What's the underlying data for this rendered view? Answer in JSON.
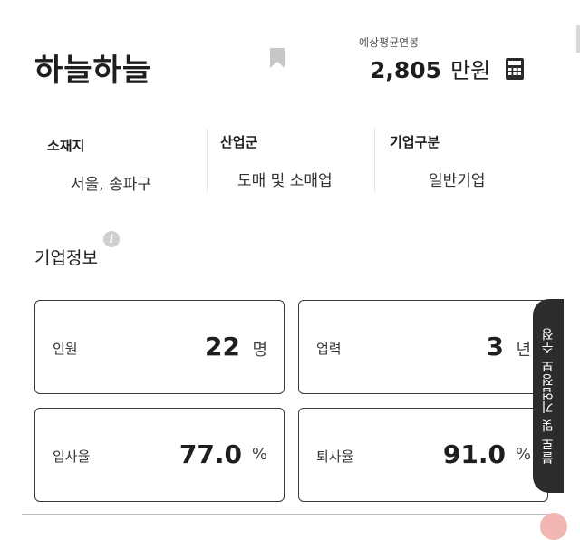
{
  "company": {
    "name": "하늘하늘"
  },
  "salary": {
    "label": "예상평균연봉",
    "value": "2,805",
    "unit": "만원"
  },
  "info": [
    {
      "label": "소재지",
      "value": "서울, 송파구"
    },
    {
      "label": "산업군",
      "value": "도매 및 소매업"
    },
    {
      "label": "기업구분",
      "value": "일반기업"
    }
  ],
  "section": {
    "title": "기업정보",
    "info_icon": "i"
  },
  "stats": {
    "employees": {
      "label": "인원",
      "value": "22",
      "unit": "명"
    },
    "years": {
      "label": "업력",
      "value": "3",
      "unit": "년"
    },
    "hire_rate": {
      "label": "입사율",
      "value": "77.0",
      "unit": "%"
    },
    "quit_rate": {
      "label": "퇴사율",
      "value": "91.0",
      "unit": "%"
    }
  },
  "side_tab": {
    "label": "블로 및 기업정보 수정"
  },
  "icons": {
    "bookmark": "bookmark-icon",
    "calculator": "calculator-icon",
    "info": "info-icon"
  },
  "colors": {
    "text": "#1e1e1e",
    "tab_bg": "#2c2c2c",
    "icon_gray": "#c7c7c7"
  }
}
